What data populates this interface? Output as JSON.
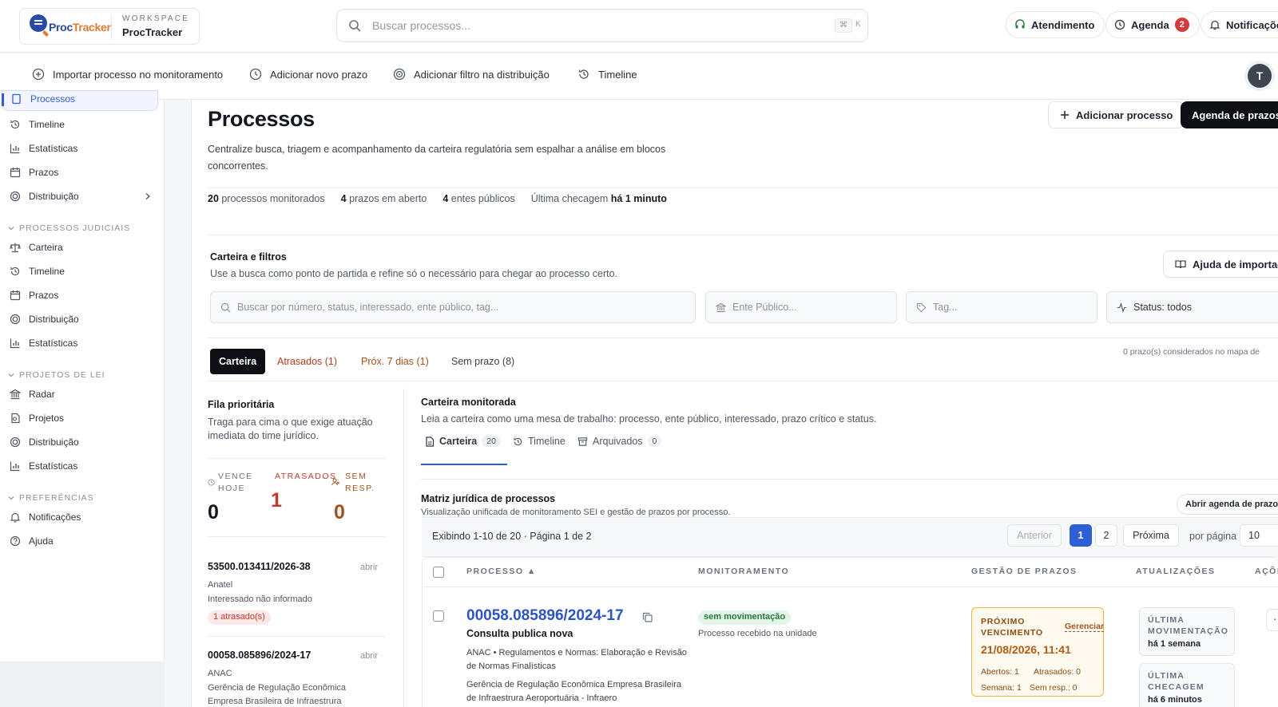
{
  "header": {
    "logo_a": "Proc",
    "logo_b": "Tracker",
    "workspace_label": "WORKSPACE",
    "workspace_name": "ProcTracker",
    "search_placeholder": "Buscar processos...",
    "kbd_mod": "⌘",
    "kbd_key": "K",
    "support_label": "Atendimento",
    "agenda_label": "Agenda",
    "agenda_count": "2",
    "notifications_label": "Notificações"
  },
  "quick_actions": {
    "import": "Importar processo no monitoramento",
    "add_deadline": "Adicionar novo prazo",
    "add_filter": "Adicionar filtro na distribuição",
    "timeline": "Timeline",
    "avatar_initial": "T"
  },
  "sidebar": {
    "top_items": [
      "Processos",
      "Timeline",
      "Estatísticas",
      "Prazos",
      "Distribuição"
    ],
    "sections": [
      {
        "title": "PROCESSOS JUDICIAIS",
        "items": [
          "Carteira",
          "Timeline",
          "Prazos",
          "Distribuição",
          "Estatísticas"
        ]
      },
      {
        "title": "PROJETOS DE LEI",
        "items": [
          "Radar",
          "Projetos",
          "Distribuição",
          "Estatísticas"
        ]
      },
      {
        "title": "PREFERÊNCIAS",
        "items": [
          "Notificações",
          "Ajuda"
        ]
      }
    ]
  },
  "page": {
    "title": "Processos",
    "description": "Centralize busca, triagem e acompanhamento da carteira regulatória sem espalhar a análise em blocos concorrentes.",
    "add_process": "Adicionar processo",
    "deadline_agenda": "Agenda de prazos",
    "stats": {
      "monitored_n": "20",
      "monitored_t": "processos monitorados",
      "open_n": "4",
      "open_t": "prazos em aberto",
      "entities_n": "4",
      "entities_t": "entes públicos",
      "check_t": "Última checagem",
      "check_v": "há 1 minuto"
    }
  },
  "filters": {
    "title": "Carteira e filtros",
    "subtitle": "Use a busca como ponto de partida e refine só o necessário para chegar ao processo certo.",
    "help_import": "Ajuda de importação",
    "search_placeholder": "Buscar por número, status, interessado, ente público, tag...",
    "entity_placeholder": "Ente Público...",
    "tag_placeholder": "Tag...",
    "status": "Status: todos"
  },
  "tabs": {
    "carteira": "Carteira",
    "atrasados": "Atrasados (1)",
    "prox7": "Próx. 7 dias (1)",
    "sem_prazo": "Sem prazo (8)",
    "note": "0 prazo(s) considerados no mapa de"
  },
  "queue": {
    "title": "Fila prioritária",
    "subtitle": "Traga para cima o que exige atuação imediata do time jurídico.",
    "kpis": {
      "today_label": "VENCE HOJE",
      "today_value": "0",
      "late_label": "ATRASADOS",
      "late_value": "1",
      "noresp_label": "SEM RESP.",
      "noresp_value": "0"
    },
    "items": [
      {
        "number": "53500.013411/2026-38",
        "open": "abrir",
        "entity": "Anatel",
        "interested": "Interessado não informado",
        "badge": "1 atrasado(s)"
      },
      {
        "number": "00058.085896/2024-17",
        "open": "abrir",
        "entity": "ANAC",
        "interested": "Gerência de Regulação Econômica",
        "interested2": "Empresa Brasileira de Infraestrura"
      }
    ]
  },
  "portfolio": {
    "title": "Carteira monitorada",
    "subtitle": "Leia a carteira como uma mesa de trabalho: processo, ente público, interessado, prazo crítico e status.",
    "subtabs": [
      {
        "label": "Carteira",
        "count": "20"
      },
      {
        "label": "Timeline"
      },
      {
        "label": "Arquivados",
        "count": "0"
      }
    ],
    "matrix_title": "Matriz jurídica de processos",
    "matrix_subtitle": "Visualização unificada de monitoramento SEI e gestão de prazos por processo.",
    "open_agenda": "Abrir agenda de prazos",
    "pager": {
      "summary": "Exibindo 1-10 de 20 · Página 1 de 2",
      "prev": "Anterior",
      "page1": "1",
      "page2": "2",
      "next": "Próxima",
      "per_page_label": "por página",
      "per_page": "10"
    },
    "columns": {
      "process": "PROCESSO ▲",
      "monitoring": "MONITORAMENTO",
      "deadlines": "GESTÃO DE PRAZOS",
      "updates": "ATUALIZAÇÕES",
      "actions": "AÇÕES"
    },
    "row": {
      "number": "00058.085896/2024-17",
      "name": "Consulta publica nova",
      "line1": "ANAC • Regulamentos e Normas: Elaboração e Revisão",
      "line2": "de Normas Finalísticas",
      "line3": "Gerência de Regulação Econômica Empresa Brasileira",
      "line4": "de Infraestrura Aeroportuária - Infraero",
      "status": "sem movimentação",
      "status_detail": "Processo recebido na unidade",
      "due_label": "PRÓXIMO VENCIMENTO",
      "due_manage": "Gerenciar",
      "due_date": "21/08/2026, 11:41",
      "open_t": "Abertos: 1",
      "late_t": "Atrasados: 0",
      "week_t": "Semana: 1",
      "noresp_t": "Sem resp.: 0",
      "upd1_label": "ÚLTIMA MOVIMENTAÇÃO",
      "upd1_value": "há 1 semana",
      "upd2_label": "ÚLTIMA CHECAGEM",
      "upd2_value": "há 6 minutos",
      "more": "···"
    }
  },
  "colors": {
    "accent": "#2f5fd6",
    "danger": "#c0392b",
    "warning": "#a3511d",
    "success": "#2b7a3d"
  }
}
